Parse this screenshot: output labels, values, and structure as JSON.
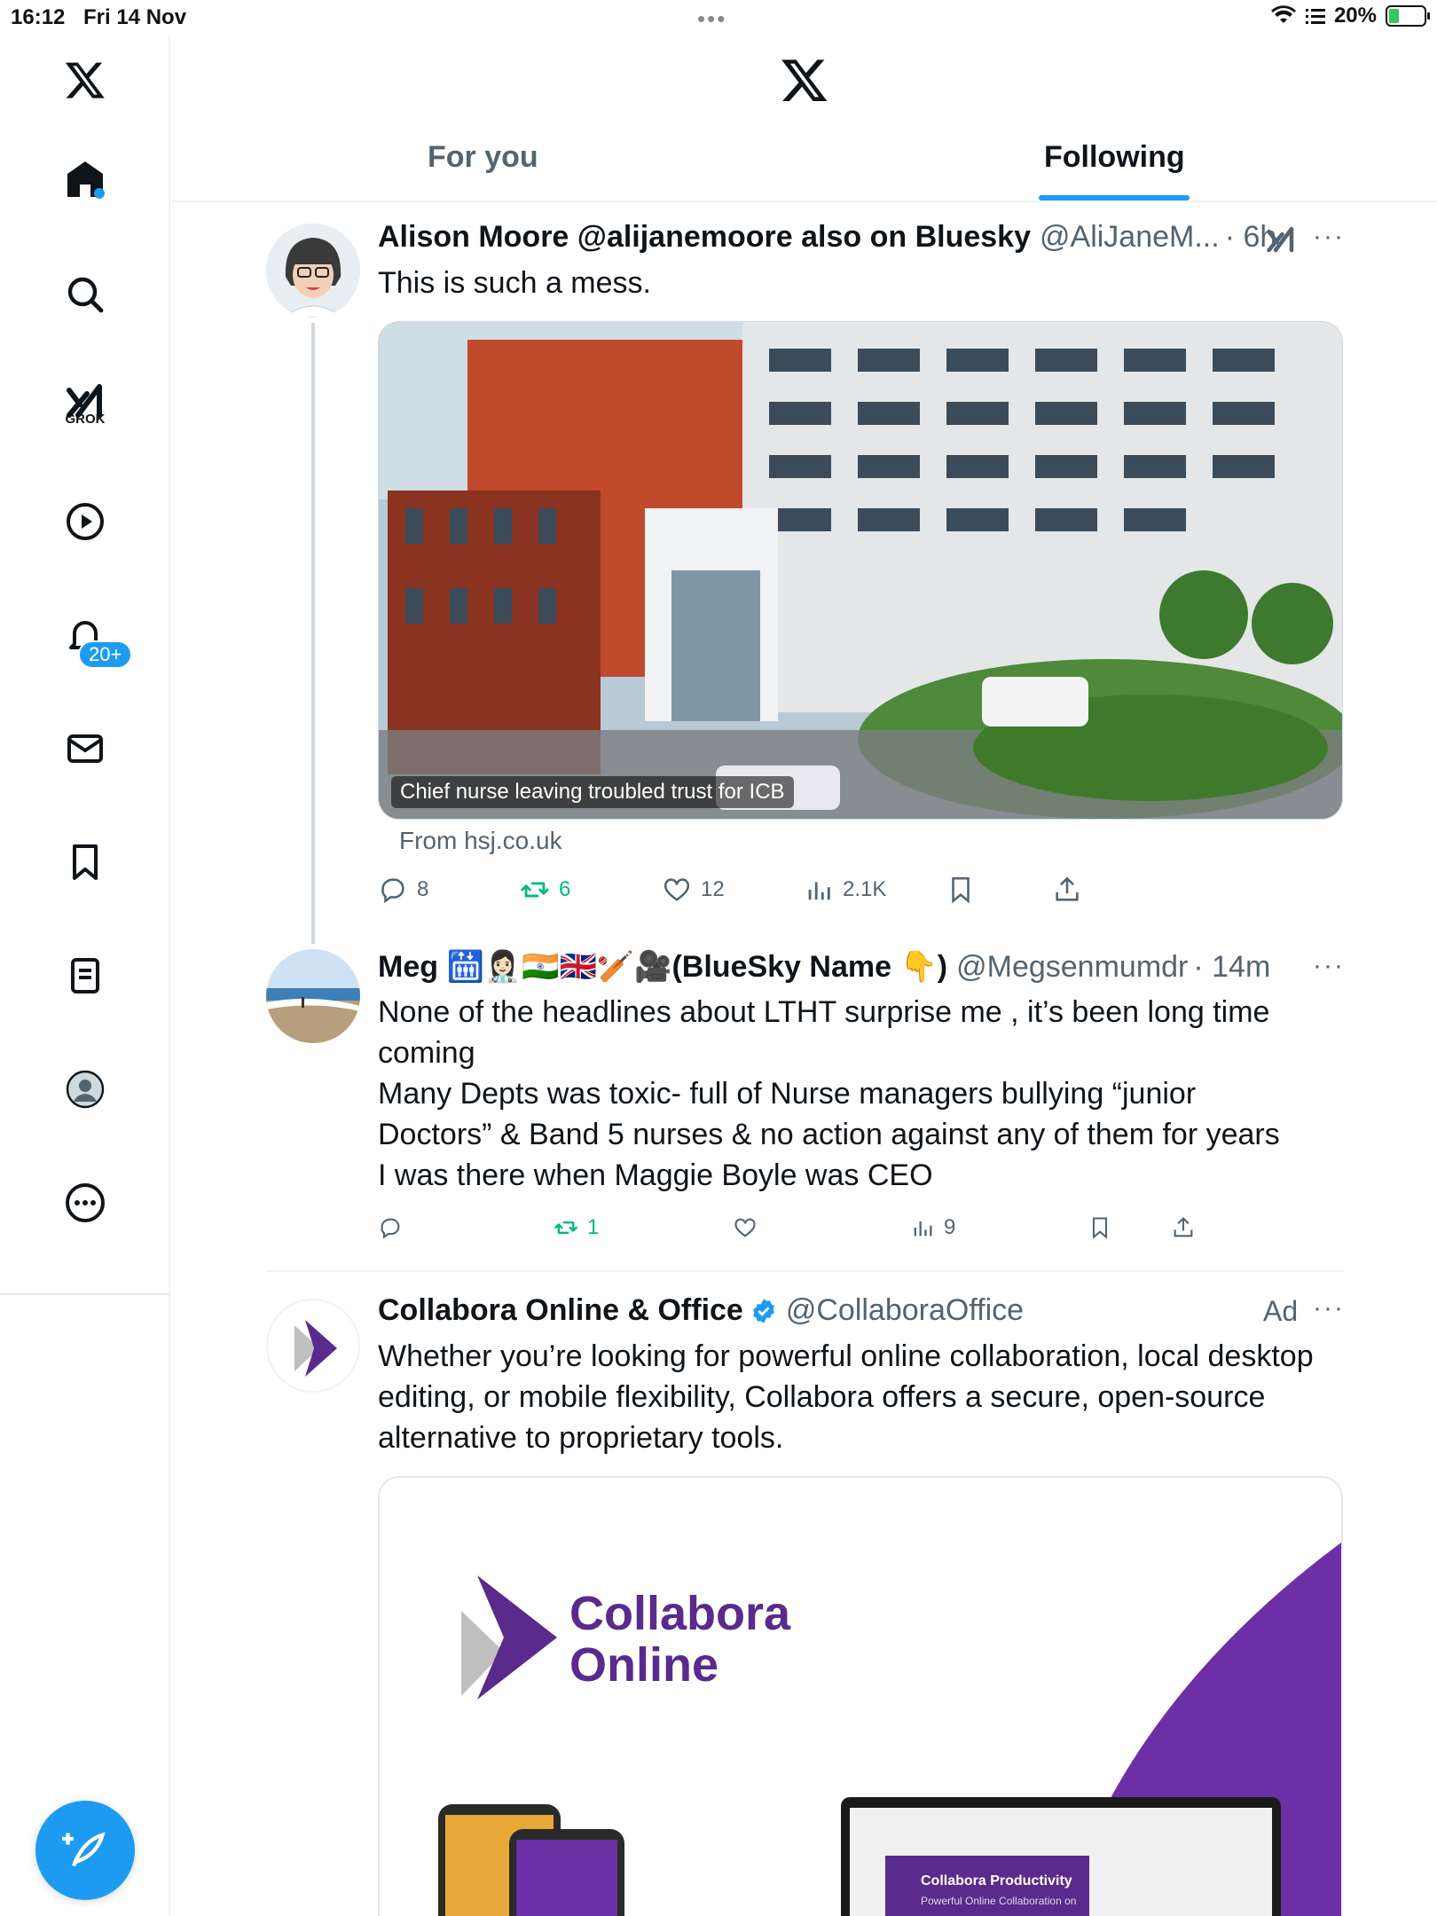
{
  "status_bar": {
    "time": "16:12",
    "date": "Fri 14 Nov",
    "battery": "20%",
    "battery_level": 0.2
  },
  "sidebar": {
    "grok_label": "GROK",
    "notification_badge": "20+",
    "items": [
      "x-logo",
      "home-icon",
      "search-icon",
      "grok-icon",
      "video-icon",
      "bell-icon",
      "mail-icon",
      "bookmark-icon",
      "list-icon",
      "profile-icon",
      "more-icon"
    ]
  },
  "header": {
    "tabs": [
      {
        "label": "For you",
        "active": false
      },
      {
        "label": "Following",
        "active": true
      }
    ]
  },
  "tweets": [
    {
      "name": "Alison Moore @alijanemoore also on Bluesky",
      "handle": "@AliJaneM...",
      "time": "· 6h",
      "text": "This is such a mess.",
      "media_caption": "Chief nurse leaving troubled trust for ICB",
      "source": "From hsj.co.uk",
      "replies": "8",
      "reposts": "6",
      "likes": "12",
      "views": "2.1K"
    },
    {
      "name": "Meg 🛗👩🏻‍⚕️🇮🇳🇬🇧🏏🎥(BlueSky Name 👇)",
      "handle": "@Megsenmumdr",
      "time": "· 14m",
      "text_lines": [
        "None of the headlines about LTHT surprise me , it’s been long time",
        "coming",
        "Many Depts was toxic- full of Nurse managers bullying “junior",
        "Doctors” & Band 5 nurses & no action against any of them for years",
        "I was there when Maggie Boyle was CEO"
      ],
      "reposts": "1",
      "views": "9"
    },
    {
      "name": "Collabora Online & Office",
      "handle": "@CollaboraOffice",
      "ad_label": "Ad",
      "text_lines": [
        "Whether you’re looking for powerful online collaboration, local desktop",
        "editing, or mobile flexibility, Collabora offers a secure, open-source",
        "alternative to proprietary tools."
      ],
      "card_brand_line1": "Collabora",
      "card_brand_line2": "Online",
      "card_screen_title": "Collabora Productivity",
      "card_screen_subtitle": "Powerful Online Collaboration on"
    }
  ],
  "colors": {
    "accent": "#1d9bf0",
    "repost_green": "#00ba7c",
    "muted": "#536471",
    "collabora_purple": "#5a2a8c"
  }
}
